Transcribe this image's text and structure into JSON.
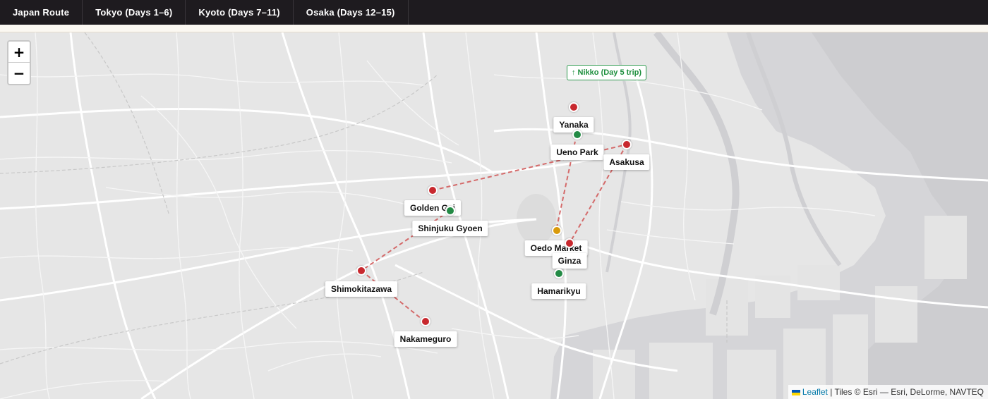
{
  "nav": {
    "tabs": [
      {
        "label": "Japan Route"
      },
      {
        "label": "Tokyo (Days 1–6)"
      },
      {
        "label": "Kyoto (Days 7–11)"
      },
      {
        "label": "Osaka (Days 12–15)"
      }
    ]
  },
  "map": {
    "colors": {
      "land": "#e6e6e6",
      "water": "#cfcfd2",
      "road": "#ffffff",
      "route_line": "#d46a6a",
      "marker_red": "#c8282e",
      "marker_green": "#238a45",
      "marker_orange": "#d99a0b"
    },
    "nikko_label": "↑ Nikko (Day 5 trip)",
    "places": {
      "yanaka": "Yanaka",
      "ueno_park": "Ueno Park",
      "asakusa": "Asakusa",
      "golden_gai": "Golden Gai",
      "shinjuku_gyoen": "Shinjuku Gyoen",
      "oedo_market": "Oedo Market",
      "ginza": "Ginza",
      "hamarikyu": "Hamarikyu",
      "shimokitazawa": "Shimokitazawa",
      "nakameguro": "Nakameguro"
    },
    "zoom": {
      "in_label": "+",
      "out_label": "−"
    },
    "attribution": {
      "link_label": "Leaflet",
      "text": " | Tiles © Esri — Esri, DeLorme, NAVTEQ"
    }
  }
}
